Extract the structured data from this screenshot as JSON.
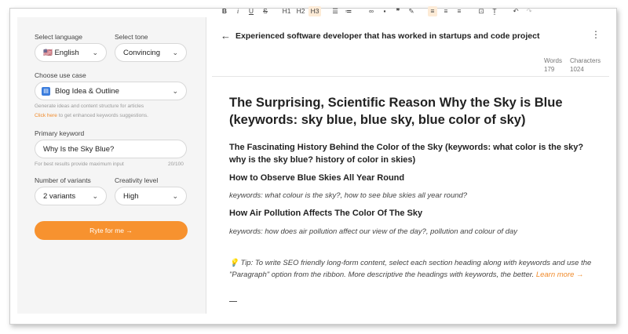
{
  "form": {
    "language_label": "Select language",
    "language_value": "🇺🇸 English",
    "tone_label": "Select tone",
    "tone_value": "Convincing",
    "use_case_label": "Choose use case",
    "use_case_value": "Blog Idea & Outline",
    "use_case_hint": "Generate ideas and content structure for articles",
    "use_case_link": "Click here",
    "use_case_link_rest": " to get enhanced keywords suggestions.",
    "keyword_label": "Primary keyword",
    "keyword_value": "Why Is the Sky Blue?",
    "keyword_hint": "For best results provide maximum input",
    "keyword_count": "20/100",
    "variants_label": "Number of variants",
    "variants_value": "2 variants",
    "creativity_label": "Creativity level",
    "creativity_value": "High",
    "submit_label": "Ryte for me →"
  },
  "header": {
    "title": "Experienced software developer that has worked in startups and code project"
  },
  "toolbar": {
    "bold": "B",
    "italic": "i",
    "underline": "U",
    "strike": "S",
    "h1": "H1",
    "h2": "H2",
    "h3": "H3",
    "words_label": "Words",
    "words_value": "179",
    "chars_label": "Characters",
    "chars_value": "1024"
  },
  "doc": {
    "h1": "The Surprising, Scientific Reason Why the Sky is Blue (keywords: sky blue, blue sky, blue color of sky)",
    "h2": "The Fascinating History Behind the Color of the Sky (keywords: what color is the sky? why is the sky blue? history of color in skies)",
    "h3a": "How to Observe Blue Skies All Year Round",
    "kw_a": "keywords: what colour is the sky?, how to see blue skies all year round?",
    "h3b": "How Air Pollution Affects The Color Of The Sky",
    "kw_b": "keywords: how does air pollution affect our view of the day?, pollution and colour of day",
    "tip": "💡 Tip: To write SEO friendly long-form content, select each section heading along with keywords and use the \"Paragraph\" option from the ribbon. More descriptive the headings with keywords, the better. ",
    "tip_link": "Learn more →"
  },
  "colors": {
    "accent": "#f7922f",
    "active_bg": "#fdebd6"
  }
}
